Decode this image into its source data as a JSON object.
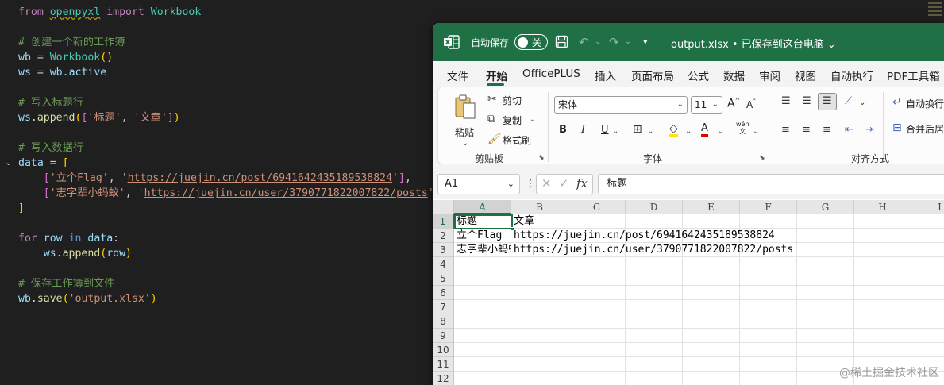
{
  "editor": {
    "lines": [
      {
        "segments": [
          {
            "t": "from",
            "c": "kw"
          },
          {
            "t": " "
          },
          {
            "t": "openpyxl",
            "c": "cls squig"
          },
          {
            "t": " "
          },
          {
            "t": "import",
            "c": "kw"
          },
          {
            "t": " "
          },
          {
            "t": "Workbook",
            "c": "cls"
          }
        ]
      },
      {
        "segments": []
      },
      {
        "segments": [
          {
            "t": "# 创建一个新的工作簿",
            "c": "cm"
          }
        ]
      },
      {
        "segments": [
          {
            "t": "wb",
            "c": "var"
          },
          {
            "t": " = "
          },
          {
            "t": "Workbook",
            "c": "cls"
          },
          {
            "t": "()",
            "c": "p1"
          }
        ]
      },
      {
        "segments": [
          {
            "t": "ws",
            "c": "var"
          },
          {
            "t": " = "
          },
          {
            "t": "wb",
            "c": "var"
          },
          {
            "t": "."
          },
          {
            "t": "active",
            "c": "var"
          }
        ]
      },
      {
        "segments": []
      },
      {
        "segments": [
          {
            "t": "# 写入标题行",
            "c": "cm"
          }
        ]
      },
      {
        "segments": [
          {
            "t": "ws",
            "c": "var"
          },
          {
            "t": "."
          },
          {
            "t": "append",
            "c": "fn"
          },
          {
            "t": "(",
            "c": "p1"
          },
          {
            "t": "[",
            "c": "p2"
          },
          {
            "t": "'标题'",
            "c": "str"
          },
          {
            "t": ", "
          },
          {
            "t": "'文章'",
            "c": "str"
          },
          {
            "t": "]",
            "c": "p2"
          },
          {
            "t": ")",
            "c": "p1"
          }
        ]
      },
      {
        "segments": []
      },
      {
        "segments": [
          {
            "t": "# 写入数据行",
            "c": "cm"
          }
        ]
      },
      {
        "segments": [
          {
            "t": "data",
            "c": "var"
          },
          {
            "t": " = "
          },
          {
            "t": "[",
            "c": "p1"
          }
        ]
      },
      {
        "segments": [
          {
            "t": "    "
          },
          {
            "t": "[",
            "c": "p2"
          },
          {
            "t": "'立个Flag'",
            "c": "str"
          },
          {
            "t": ", "
          },
          {
            "t": "'",
            "c": "str"
          },
          {
            "t": "https://juejin.cn/post/6941642435189538824",
            "c": "str url"
          },
          {
            "t": "'",
            "c": "str"
          },
          {
            "t": "]",
            "c": "p2"
          },
          {
            "t": ","
          }
        ]
      },
      {
        "segments": [
          {
            "t": "    "
          },
          {
            "t": "[",
            "c": "p2"
          },
          {
            "t": "'志字辈小蚂蚁'",
            "c": "str"
          },
          {
            "t": ", "
          },
          {
            "t": "'",
            "c": "str"
          },
          {
            "t": "https://juejin.cn/user/3790771822007822/posts",
            "c": "str url"
          },
          {
            "t": "'",
            "c": "str"
          },
          {
            "t": "]",
            "c": "p2"
          }
        ]
      },
      {
        "segments": [
          {
            "t": "]",
            "c": "p1"
          }
        ]
      },
      {
        "segments": []
      },
      {
        "segments": [
          {
            "t": "for",
            "c": "kw"
          },
          {
            "t": " "
          },
          {
            "t": "row",
            "c": "var"
          },
          {
            "t": " "
          },
          {
            "t": "in",
            "c": "kwb"
          },
          {
            "t": " "
          },
          {
            "t": "data",
            "c": "var"
          },
          {
            "t": ":"
          }
        ]
      },
      {
        "segments": [
          {
            "t": "    "
          },
          {
            "t": "ws",
            "c": "var"
          },
          {
            "t": "."
          },
          {
            "t": "append",
            "c": "fn"
          },
          {
            "t": "(",
            "c": "p1"
          },
          {
            "t": "row",
            "c": "var"
          },
          {
            "t": ")",
            "c": "p1"
          }
        ]
      },
      {
        "segments": []
      },
      {
        "segments": [
          {
            "t": "# 保存工作簿到文件",
            "c": "cm"
          }
        ]
      },
      {
        "segments": [
          {
            "t": "wb",
            "c": "var"
          },
          {
            "t": "."
          },
          {
            "t": "save",
            "c": "fn"
          },
          {
            "t": "(",
            "c": "p1"
          },
          {
            "t": "'output.xlsx'",
            "c": "str"
          },
          {
            "t": ")",
            "c": "p1"
          }
        ]
      }
    ]
  },
  "excel": {
    "titlebar": {
      "autosave_label": "自动保存",
      "toggle_state": "关",
      "filename": "output.xlsx • 已保存到这台电脑",
      "filename_chevron": "⌄"
    },
    "menu": [
      "文件",
      "开始",
      "OfficePLUS",
      "插入",
      "页面布局",
      "公式",
      "数据",
      "审阅",
      "视图",
      "自动执行",
      "PDF工具箱"
    ],
    "ribbon": {
      "paste_label": "粘贴",
      "cut_label": "剪切",
      "copy_label": "复制",
      "format_painter_label": "格式刷",
      "clipboard_group": "剪贴板",
      "font_name": "宋体",
      "font_size": "11",
      "font_group": "字体",
      "align_group": "对齐方式",
      "wrap_text_label": "自动换行",
      "merge_label": "合并后居",
      "bold": "B",
      "italic": "I",
      "underline": "U",
      "font_grow": "A",
      "font_shrink": "A",
      "phonetic": "wén"
    },
    "formula_bar": {
      "name_box": "A1",
      "fx": "fx",
      "formula": "标题"
    },
    "columns": [
      "A",
      "B",
      "C",
      "D",
      "E",
      "F",
      "G",
      "H",
      "I"
    ],
    "rows": [
      "1",
      "2",
      "3",
      "4",
      "5",
      "6",
      "7",
      "8",
      "9",
      "10",
      "11",
      "12"
    ],
    "cells": [
      {
        "row": 1,
        "col": "A",
        "value": "标题"
      },
      {
        "row": 1,
        "col": "B",
        "value": "文章"
      },
      {
        "row": 2,
        "col": "A",
        "value": "立个Flag"
      },
      {
        "row": 2,
        "col": "B",
        "value": "https://juejin.cn/post/6941642435189538824"
      },
      {
        "row": 3,
        "col": "A",
        "value": "志字辈小蚂蚁"
      },
      {
        "row": 3,
        "col": "B",
        "value": "https://juejin.cn/user/3790771822007822/posts"
      }
    ],
    "active_cell": "A1",
    "watermark": "@稀土掘金技术社区"
  }
}
